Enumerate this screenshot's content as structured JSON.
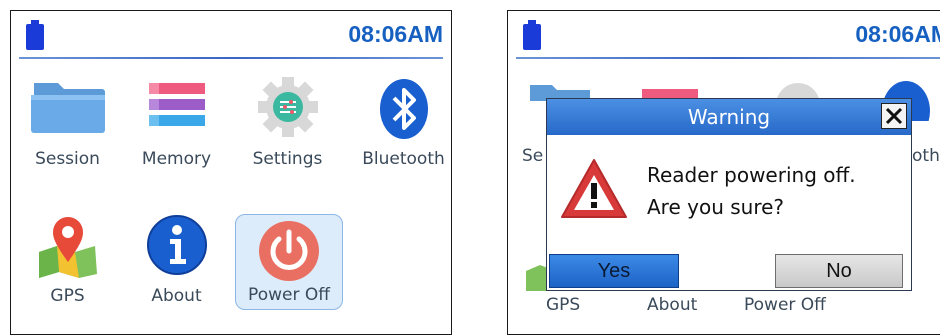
{
  "left_screen": {
    "status": {
      "time": "08:06AM",
      "battery_icon": "battery-icon"
    },
    "menu": [
      {
        "id": "session",
        "label": "Session",
        "icon": "folder-icon"
      },
      {
        "id": "memory",
        "label": "Memory",
        "icon": "memory-icon"
      },
      {
        "id": "settings",
        "label": "Settings",
        "icon": "gear-icon"
      },
      {
        "id": "bluetooth",
        "label": "Bluetooth",
        "icon": "bluetooth-icon"
      },
      {
        "id": "gps",
        "label": "GPS",
        "icon": "map-pin-icon"
      },
      {
        "id": "about",
        "label": "About",
        "icon": "info-icon"
      },
      {
        "id": "poweroff",
        "label": "Power Off",
        "icon": "power-icon",
        "selected": true
      }
    ]
  },
  "right_screen": {
    "status": {
      "time": "08:06AM",
      "battery_icon": "battery-icon"
    },
    "background_labels": [
      "Se",
      "oth",
      "GPS",
      "About",
      "Power Off"
    ],
    "dialog": {
      "title": "Warning",
      "close_icon": "close-icon",
      "warning_icon": "warning-triangle-icon",
      "message_line1": "Reader powering off.",
      "message_line2": "Are you sure?",
      "yes_label": "Yes",
      "no_label": "No"
    }
  },
  "colors": {
    "accent_blue": "#1560c0",
    "titlebar_blue": "#2f74d3",
    "selected_tile_bg": "#dcecfb",
    "power_red": "#ea6f63",
    "warning_red": "#d83a3a"
  }
}
